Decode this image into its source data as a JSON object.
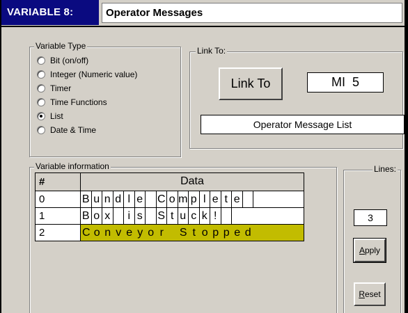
{
  "header": {
    "variable_label": "VARIABLE 8:",
    "variable_name": "Operator Messages"
  },
  "variable_type": {
    "legend": "Variable Type",
    "options": [
      {
        "label": "Bit (on/off)",
        "selected": false
      },
      {
        "label": "Integer (Numeric value)",
        "selected": false
      },
      {
        "label": "Timer",
        "selected": false
      },
      {
        "label": "Time Functions",
        "selected": false
      },
      {
        "label": "List",
        "selected": true
      },
      {
        "label": "Date & Time",
        "selected": false
      }
    ]
  },
  "link": {
    "legend": "Link To:",
    "button_label": "Link To",
    "linked_address": "MI  5",
    "linked_name": "Operator Message List"
  },
  "variable_info": {
    "legend": "Variable information",
    "header_num": "#",
    "header_data": "Data",
    "rows": [
      {
        "num": "0",
        "text": "Bundle Complete",
        "highlighted": false
      },
      {
        "num": "1",
        "text": "Box is Stuck!",
        "highlighted": false
      },
      {
        "num": "2",
        "text": "Conveyor Stopped",
        "highlighted": true
      }
    ],
    "highlight_color": "#c2bc00"
  },
  "lines": {
    "legend": "Lines:",
    "value": "3",
    "apply_label": "Apply",
    "reset_label": "Reset"
  },
  "colors": {
    "title_bg": "#0a0a80",
    "dialog_bg": "#d4d0c8"
  }
}
